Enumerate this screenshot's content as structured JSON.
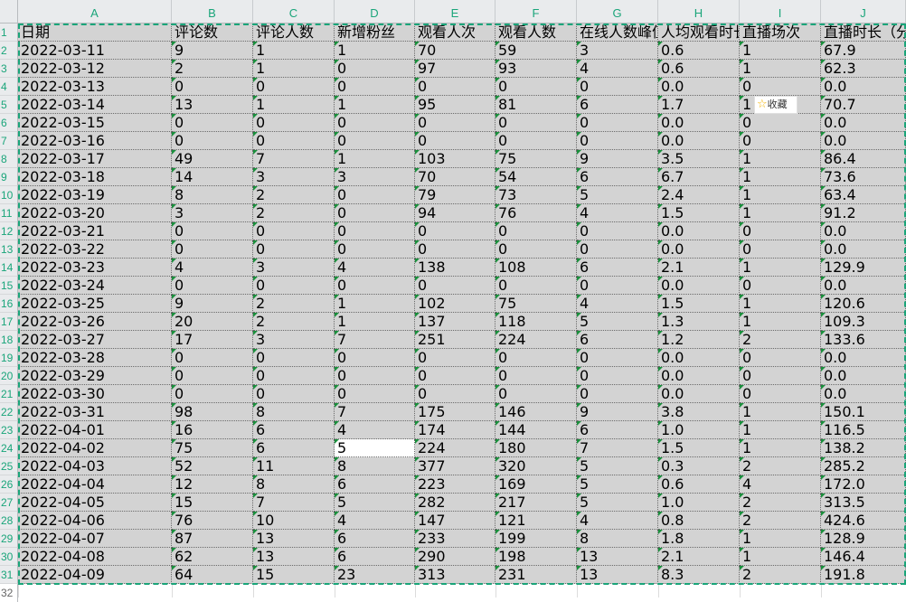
{
  "column_letters": [
    "A",
    "B",
    "C",
    "D",
    "E",
    "F",
    "G",
    "H",
    "I",
    "J"
  ],
  "header_row": [
    "日期",
    "评论数",
    "评论人数",
    "新增粉丝",
    "观看人次",
    "观看人数",
    "在线人数峰值",
    "人均观看时长",
    "直播场次",
    "直播时长（分"
  ],
  "rows": [
    [
      "2022-03-11",
      "9",
      "1",
      "1",
      "70",
      "59",
      "3",
      "0.6",
      "1",
      "67.9"
    ],
    [
      "2022-03-12",
      "2",
      "1",
      "0",
      "97",
      "93",
      "4",
      "0.6",
      "1",
      "62.3"
    ],
    [
      "2022-03-13",
      "0",
      "0",
      "0",
      "0",
      "0",
      "0",
      "0.0",
      "0",
      "0.0"
    ],
    [
      "2022-03-14",
      "13",
      "1",
      "1",
      "95",
      "81",
      "6",
      "1.7",
      "1",
      "70.7"
    ],
    [
      "2022-03-15",
      "0",
      "0",
      "0",
      "0",
      "0",
      "0",
      "0.0",
      "0",
      "0.0"
    ],
    [
      "2022-03-16",
      "0",
      "0",
      "0",
      "0",
      "0",
      "0",
      "0.0",
      "0",
      "0.0"
    ],
    [
      "2022-03-17",
      "49",
      "7",
      "1",
      "103",
      "75",
      "9",
      "3.5",
      "1",
      "86.4"
    ],
    [
      "2022-03-18",
      "14",
      "3",
      "3",
      "70",
      "54",
      "6",
      "6.7",
      "1",
      "73.6"
    ],
    [
      "2022-03-19",
      "8",
      "2",
      "0",
      "79",
      "73",
      "5",
      "2.4",
      "1",
      "63.4"
    ],
    [
      "2022-03-20",
      "3",
      "2",
      "0",
      "94",
      "76",
      "4",
      "1.5",
      "1",
      "91.2"
    ],
    [
      "2022-03-21",
      "0",
      "0",
      "0",
      "0",
      "0",
      "0",
      "0.0",
      "0",
      "0.0"
    ],
    [
      "2022-03-22",
      "0",
      "0",
      "0",
      "0",
      "0",
      "0",
      "0.0",
      "0",
      "0.0"
    ],
    [
      "2022-03-23",
      "4",
      "3",
      "4",
      "138",
      "108",
      "6",
      "2.1",
      "1",
      "129.9"
    ],
    [
      "2022-03-24",
      "0",
      "0",
      "0",
      "0",
      "0",
      "0",
      "0.0",
      "0",
      "0.0"
    ],
    [
      "2022-03-25",
      "9",
      "2",
      "1",
      "102",
      "75",
      "4",
      "1.5",
      "1",
      "120.6"
    ],
    [
      "2022-03-26",
      "20",
      "2",
      "1",
      "137",
      "118",
      "5",
      "1.3",
      "1",
      "109.3"
    ],
    [
      "2022-03-27",
      "17",
      "3",
      "7",
      "251",
      "224",
      "6",
      "1.2",
      "2",
      "133.6"
    ],
    [
      "2022-03-28",
      "0",
      "0",
      "0",
      "0",
      "0",
      "0",
      "0.0",
      "0",
      "0.0"
    ],
    [
      "2022-03-29",
      "0",
      "0",
      "0",
      "0",
      "0",
      "0",
      "0.0",
      "0",
      "0.0"
    ],
    [
      "2022-03-30",
      "0",
      "0",
      "0",
      "0",
      "0",
      "0",
      "0.0",
      "0",
      "0.0"
    ],
    [
      "2022-03-31",
      "98",
      "8",
      "7",
      "175",
      "146",
      "9",
      "3.8",
      "1",
      "150.1"
    ],
    [
      "2022-04-01",
      "16",
      "6",
      "4",
      "174",
      "144",
      "6",
      "1.0",
      "1",
      "116.5"
    ],
    [
      "2022-04-02",
      "75",
      "6",
      "5",
      "224",
      "180",
      "7",
      "1.5",
      "1",
      "138.2"
    ],
    [
      "2022-04-03",
      "52",
      "11",
      "8",
      "377",
      "320",
      "5",
      "0.3",
      "2",
      "285.2"
    ],
    [
      "2022-04-04",
      "12",
      "8",
      "6",
      "223",
      "169",
      "5",
      "0.6",
      "4",
      "172.0"
    ],
    [
      "2022-04-05",
      "15",
      "7",
      "5",
      "282",
      "217",
      "5",
      "1.0",
      "2",
      "313.5"
    ],
    [
      "2022-04-06",
      "76",
      "10",
      "4",
      "147",
      "121",
      "4",
      "0.8",
      "2",
      "424.6"
    ],
    [
      "2022-04-07",
      "87",
      "13",
      "6",
      "233",
      "199",
      "8",
      "1.8",
      "1",
      "128.9"
    ],
    [
      "2022-04-08",
      "62",
      "13",
      "6",
      "290",
      "198",
      "13",
      "2.1",
      "1",
      "146.4"
    ],
    [
      "2022-04-09",
      "64",
      "15",
      "23",
      "313",
      "231",
      "13",
      "8.3",
      "2",
      "191.8"
    ]
  ],
  "row_numbers": [
    "1",
    "2",
    "3",
    "4",
    "5",
    "6",
    "7",
    "8",
    "9",
    "10",
    "11",
    "12",
    "13",
    "14",
    "15",
    "16",
    "17",
    "18",
    "19",
    "20",
    "21",
    "22",
    "23",
    "24",
    "25",
    "26",
    "27",
    "28",
    "29",
    "30",
    "31",
    "32"
  ],
  "active_cell": {
    "ref": "D24"
  },
  "tooltip": {
    "icon": "star-icon",
    "label": "收藏"
  },
  "colors": {
    "accent": "#1aa57a",
    "cell_fill": "#d3d3d3",
    "star": "#f4b400"
  }
}
